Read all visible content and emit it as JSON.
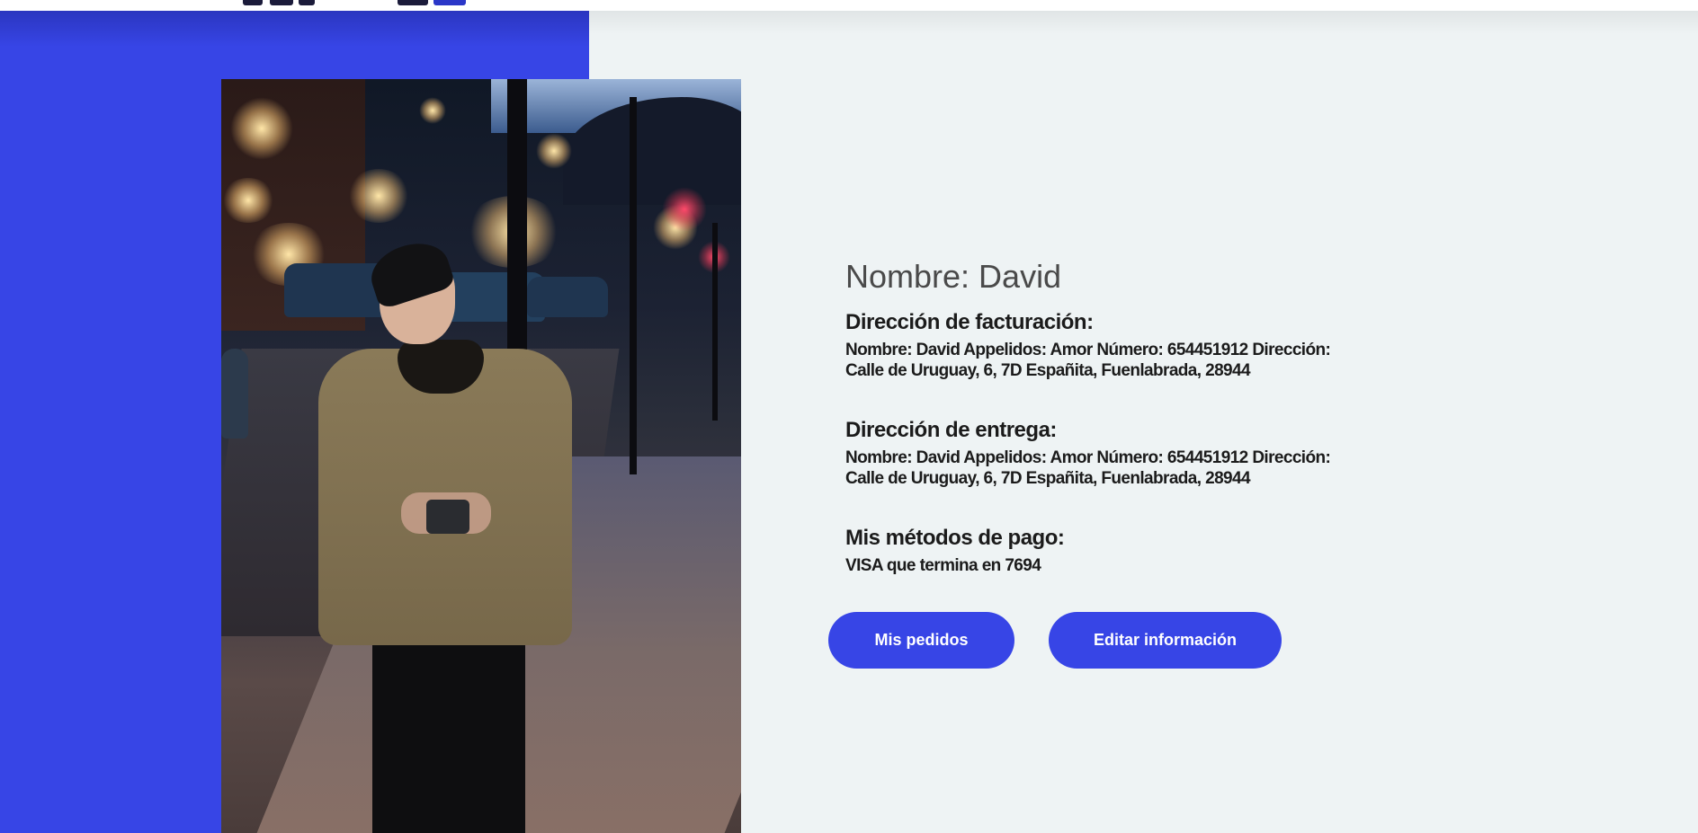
{
  "profile": {
    "name_line": "Nombre: David",
    "billing": {
      "heading": "Dirección de facturación:",
      "text": "Nombre: David Appelidos: Amor Número: 654451912 Dirección: Calle de Uruguay, 6, 7D Españita, Fuenlabrada, 28944"
    },
    "shipping": {
      "heading": "Dirección de entrega:",
      "text": "Nombre: David Appelidos: Amor Número: 654451912 Dirección: Calle de Uruguay, 6, 7D Españita, Fuenlabrada, 28944"
    },
    "payment": {
      "heading": "Mis métodos de pago:",
      "text": "VISA que termina en 7694"
    }
  },
  "actions": {
    "orders_label": "Mis pedidos",
    "edit_label": "Editar información"
  },
  "colors": {
    "accent": "#3745e6",
    "background": "#eef3f4"
  }
}
